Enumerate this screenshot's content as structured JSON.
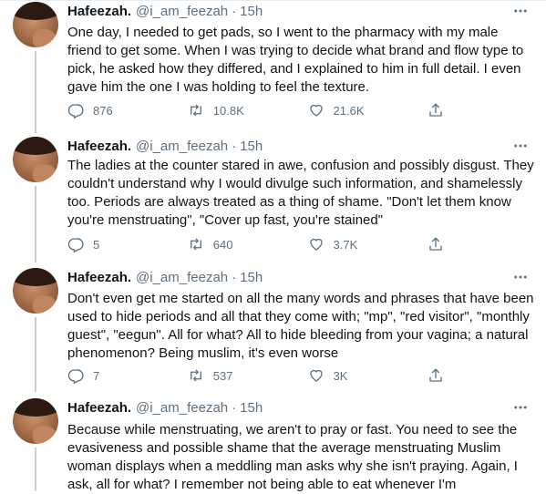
{
  "tweets": [
    {
      "name": "Hafeezah.",
      "handle": "@i_am_feezah",
      "time": "15h",
      "text": "One day, I needed to get pads, so I went to the pharmacy with my male friend to get some. When I was trying to decide what brand and flow type to pick, he asked how they differed, and I explained to him in full detail. I even gave him the one I was holding to feel the texture.",
      "replies": "876",
      "retweets": "10.8K",
      "likes": "21.6K"
    },
    {
      "name": "Hafeezah.",
      "handle": "@i_am_feezah",
      "time": "15h",
      "text": "The ladies at the counter stared in awe, confusion and possibly disgust. They couldn't understand why I would divulge such information, and shamelessly too. Periods are always treated as a thing of shame. \"Don't let them know you're menstruating\", \"Cover up fast, you're stained\"",
      "replies": "5",
      "retweets": "640",
      "likes": "3.7K"
    },
    {
      "name": "Hafeezah.",
      "handle": "@i_am_feezah",
      "time": "15h",
      "text": "Don't even get me started on all the many words and phrases that have been used to hide periods and all that they come with; \"mp\", \"red visitor\", \"monthly guest\", \"eegun\". All for what? All to hide bleeding from your vagina; a natural phenomenon? Being muslim, it's even worse",
      "replies": "7",
      "retweets": "537",
      "likes": "3K"
    },
    {
      "name": "Hafeezah.",
      "handle": "@i_am_feezah",
      "time": "15h",
      "text": "Because while menstruating, we aren't to pray or fast. You need to see the evasiveness and possible shame that the average menstruating Muslim woman displays when a meddling man asks why she isn't praying. Again, I ask, all for what? I remember not being able to eat whenever I'm"
    }
  ],
  "separator": "·",
  "colors": {
    "text": "#0f1419",
    "secondary": "#5b7083",
    "divider": "#e6ecf0",
    "thread_line": "#c4cfd6"
  },
  "icons": [
    "reply-icon",
    "retweet-icon",
    "like-icon",
    "share-icon",
    "more-icon"
  ]
}
